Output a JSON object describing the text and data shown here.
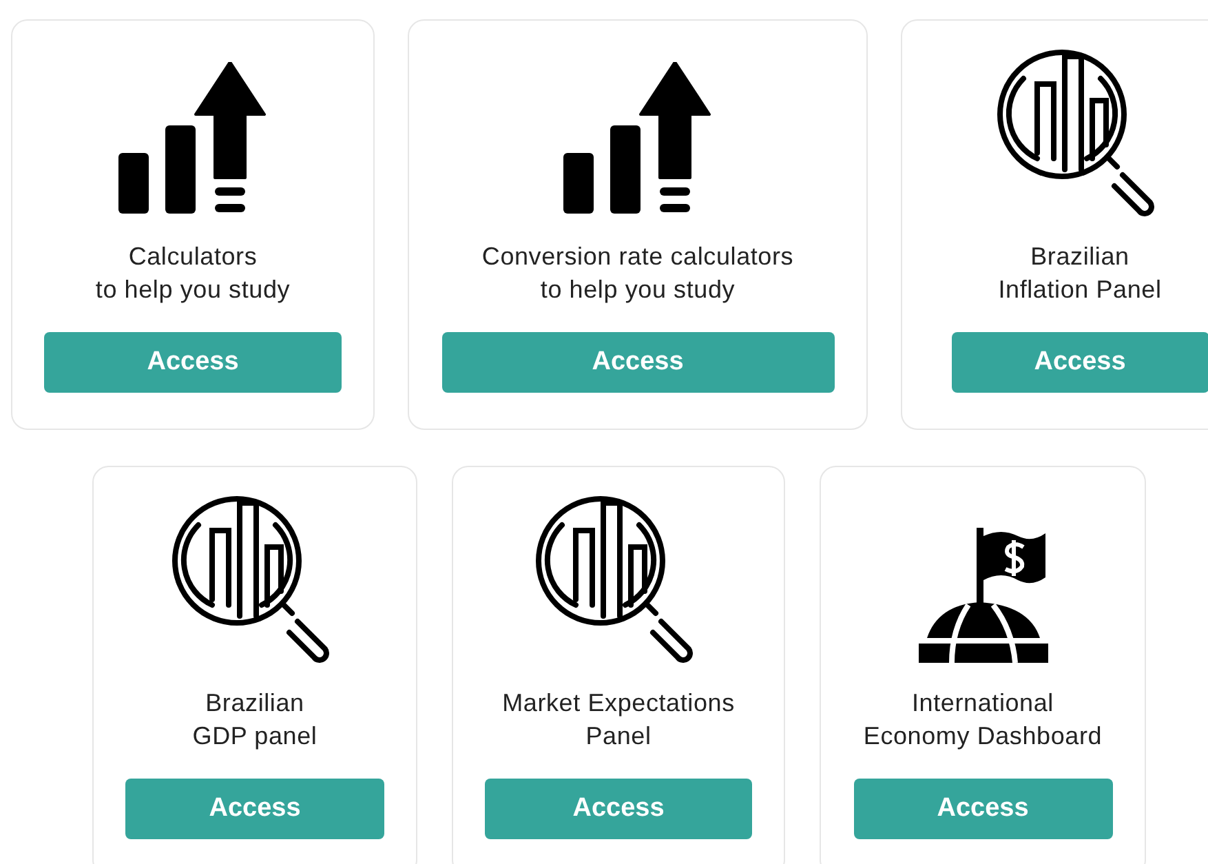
{
  "rows": [
    {
      "cards": [
        {
          "kind": "growth",
          "lines": [
            "Calculators",
            "to help you study"
          ],
          "button": "Access"
        },
        {
          "kind": "growth",
          "lines": [
            "Conversion rate calculators",
            "to help you study"
          ],
          "button": "Access"
        },
        {
          "kind": "magnifier",
          "lines": [
            "Brazilian",
            "Inflation Panel"
          ],
          "button": "Access"
        }
      ]
    },
    {
      "cards": [
        {
          "kind": "magnifier",
          "lines": [
            "Brazilian",
            "GDP panel"
          ],
          "button": "Access"
        },
        {
          "kind": "magnifier",
          "lines": [
            "Market Expectations",
            "Panel"
          ],
          "button": "Access"
        },
        {
          "kind": "globe",
          "lines": [
            "International",
            "Economy Dashboard"
          ],
          "button": "Access"
        }
      ]
    }
  ]
}
